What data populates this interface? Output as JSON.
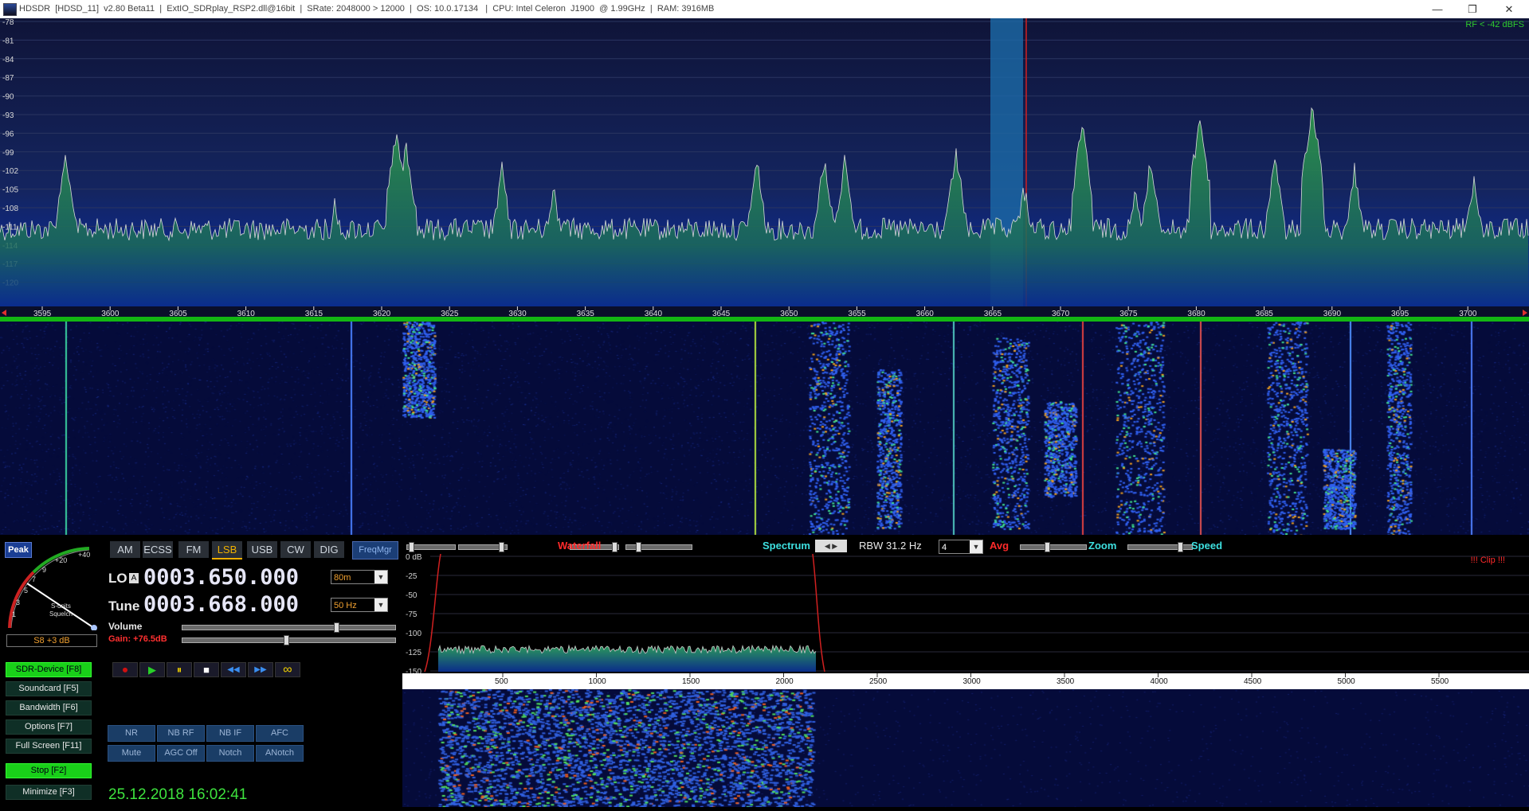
{
  "titlebar": {
    "text": "HDSDR  [HDSD_11]  v2.80 Beta11  |  ExtIO_SDRplay_RSP2.dll@16bit  |  SRate: 2048000 > 12000  |  OS: 10.0.17134   |  CPU: Intel Celeron  J1900  @ 1.99GHz  |  RAM: 3916MB",
    "min": "—",
    "max": "❐",
    "close": "✕"
  },
  "spectrum": {
    "rf_label": "RF < -42 dBFS",
    "db_labels": [
      "-78",
      "-81",
      "-84",
      "-87",
      "-90",
      "-93",
      "-96",
      "-99",
      "-102",
      "-105",
      "-108",
      "-111",
      "-114",
      "-117",
      "-120"
    ],
    "freq_labels": [
      "3595",
      "3600",
      "3605",
      "3610",
      "3615",
      "3620",
      "3625",
      "3630",
      "3635",
      "3640",
      "3645",
      "3650",
      "3655",
      "3660",
      "3665",
      "3670",
      "3675",
      "3680",
      "3685",
      "3690",
      "3695",
      "3700"
    ]
  },
  "smeter": {
    "peak_label": "Peak",
    "scale_labels": [
      "1",
      "3",
      "5",
      "7",
      "9",
      "+20",
      "+40"
    ],
    "sub_label_1": "S-units",
    "sub_label_2": "Squelch",
    "readout": "S8 +3 dB"
  },
  "function_buttons": [
    {
      "label": "SDR-Device [F8]",
      "active": true
    },
    {
      "label": "Soundcard  [F5]",
      "active": false
    },
    {
      "label": "Bandwidth  [F6]",
      "active": false
    },
    {
      "label": "Options    [F7]",
      "active": false
    },
    {
      "label": "Full Screen  [F11]",
      "active": false
    },
    {
      "label": "Stop      [F2]",
      "active": true
    },
    {
      "label": "Minimize  [F3]",
      "active": false
    }
  ],
  "modes": [
    "AM",
    "ECSS",
    "FM",
    "LSB",
    "USB",
    "CW",
    "DIG"
  ],
  "active_mode": "LSB",
  "freqmgr_label": "FreqMgr",
  "lo": {
    "label": "LO",
    "badge": "A",
    "value": "0003.650.000",
    "band": "80m"
  },
  "tune": {
    "label": "Tune",
    "value": "0003.668.000",
    "step": "50 Hz"
  },
  "volume": {
    "label": "Volume",
    "level": 0.73
  },
  "gain": {
    "label": "Gain: +76.5dB",
    "level": 0.49
  },
  "playback": {
    "record": "⏺",
    "play": "▶",
    "pause": "⏸",
    "stop": "■",
    "rewind": "◀◀",
    "forward": "▶▶",
    "loop": "∞"
  },
  "dsp_buttons": [
    [
      "NR",
      "NB RF",
      "NB IF",
      "AFC"
    ],
    [
      "Mute",
      "AGC Off",
      "Notch",
      "ANotch"
    ]
  ],
  "clock": "25.12.2018 16:02:41",
  "toolbar": {
    "waterfall": "Waterfall",
    "spectrum": "Spectrum",
    "rbw": "RBW 31.2 Hz",
    "avg_value": "4",
    "avg": "Avg",
    "zoom": "Zoom",
    "speed": "Speed"
  },
  "audio": {
    "clip": "!!! Clip !!!",
    "db_labels": [
      "0 dB",
      "-25",
      "-50",
      "-75",
      "-100",
      "-125",
      "-150"
    ],
    "freq_labels": [
      "500",
      "1000",
      "1500",
      "2000",
      "2500",
      "3000",
      "3500",
      "4000",
      "4500",
      "5000",
      "5500"
    ]
  },
  "colors": {
    "accent_green": "#19d019",
    "mode_active": "#f0b000",
    "waterfall_label": "#ff2a2a",
    "spectrum_label": "#3ee0e0"
  }
}
